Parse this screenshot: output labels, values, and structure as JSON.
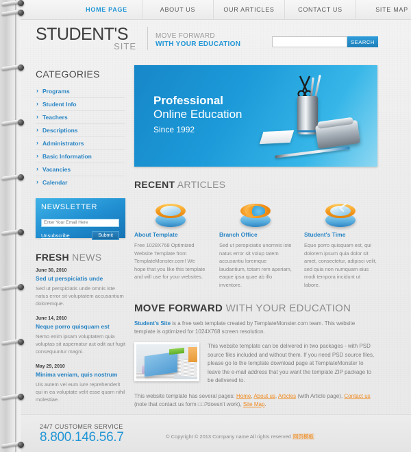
{
  "nav": {
    "items": [
      {
        "label": "HOME PAGE",
        "active": true
      },
      {
        "label": "ABOUT US",
        "active": false
      },
      {
        "label": "OUR ARTICLES",
        "active": false
      },
      {
        "label": "CONTACT US",
        "active": false
      },
      {
        "label": "SITE MAP",
        "active": false
      }
    ]
  },
  "header": {
    "logo_main": "STUDENT'S",
    "logo_sub": "SITE",
    "tagline_line1": "MOVE FORWARD",
    "tagline_line2": "WITH YOUR EDUCATION",
    "search_value": "",
    "search_placeholder": "",
    "search_button": "SEARCH"
  },
  "sidebar": {
    "categories_title": "CATEGORIES",
    "categories": [
      {
        "label": "Programs"
      },
      {
        "label": "Student Info"
      },
      {
        "label": "Teachers"
      },
      {
        "label": "Descriptions"
      },
      {
        "label": "Administrators"
      },
      {
        "label": "Basic Information"
      },
      {
        "label": "Vacancies"
      },
      {
        "label": "Calendar"
      }
    ],
    "newsletter": {
      "title": "NEWSLETTER",
      "input_value": "",
      "input_placeholder": "Enter Your Email Here",
      "unsubscribe_label": "Unsubscribe",
      "submit_label": "Submit"
    },
    "fresh_news": {
      "title_bold": "FRESH",
      "title_light": "NEWS",
      "items": [
        {
          "date": "June 30, 2010",
          "title": "Sed ut perspiciatis unde",
          "text": "Sed ut perspiciatis unde omnis iste natus error sit voluptatem accusantium doloremque."
        },
        {
          "date": "June 14, 2010",
          "title": "Neque porro quisquam est",
          "text": "Nemo enim ipsam voluptatem quia voluptas sit aspernatur aut odit aut fugit consequuntur magni."
        },
        {
          "date": "May 29, 2010",
          "title": "Minima veniam, quis nostrum",
          "text": "Uis autem vel eum iure reprehenderit qui in ea voluptate velit esse quam nihil molestiae."
        }
      ]
    }
  },
  "hero": {
    "line1": "Professional",
    "line2": "Online Education",
    "line3": "Since 1992"
  },
  "recent": {
    "title_bold": "RECENT",
    "title_light": "ARTICLES",
    "columns": [
      {
        "icon": "disc-icon",
        "title": "About Template",
        "text": "Free 1028X768 Optimized Website Template from TemplateMonster.com! We hope that you like this template and will use for your websites."
      },
      {
        "icon": "globe-icon",
        "title": "Branch Office",
        "text": "Sed ut perspiciatis unomnis iste natus error sit volup tatem accusantiu loremque laudantium, totam rem aperiam, eaque ipsa quae ab illo inventore."
      },
      {
        "icon": "clock-icon",
        "title": "Student's Time",
        "text": "Eque porro quisquam est, qui dolorem ipsum quia dolor sit amet, consectetur, adipisci velit, sed quia non numquam eius modi tempora incidunt ut labore."
      }
    ]
  },
  "move_forward": {
    "title_bold": "MOVE FORWARD",
    "title_light": "WITH YOUR EDUCATION",
    "intro_link": "Student's Site",
    "intro_text": " is a free web template created by TemplateMonster.com team. This website template is optimized for 1024X768 screen resolution.",
    "body_text": "This website template can be delivered in two packages - with PSD source files included and without them. If you need PSD source files, please go to the template download page at TemplateMonster to leave the e-mail address that you want the template ZIP package to be delivered to.",
    "links_prefix": "This website template has several pages: ",
    "link_home": "Home",
    "link_about": "About us",
    "link_articles": "Articles",
    "links_mid": " (with Article page), ",
    "link_contact": "Contact us",
    "links_note": "(note that contact us form □□?doesn't work), ",
    "link_sitemap": "Site Map",
    "links_end": "."
  },
  "footer": {
    "service_label": "24/7 CUSTOMER SERVICE",
    "phone": "8.800.146.56.7",
    "copyright_text": "© Copyright © 2013 Company name All rights reserved ",
    "copyright_cn": "网页模板"
  },
  "colors": {
    "accent_blue": "#2196d6",
    "link_blue": "#2784c4",
    "orange": "#ef8b22",
    "page_bg": "#ededed"
  }
}
